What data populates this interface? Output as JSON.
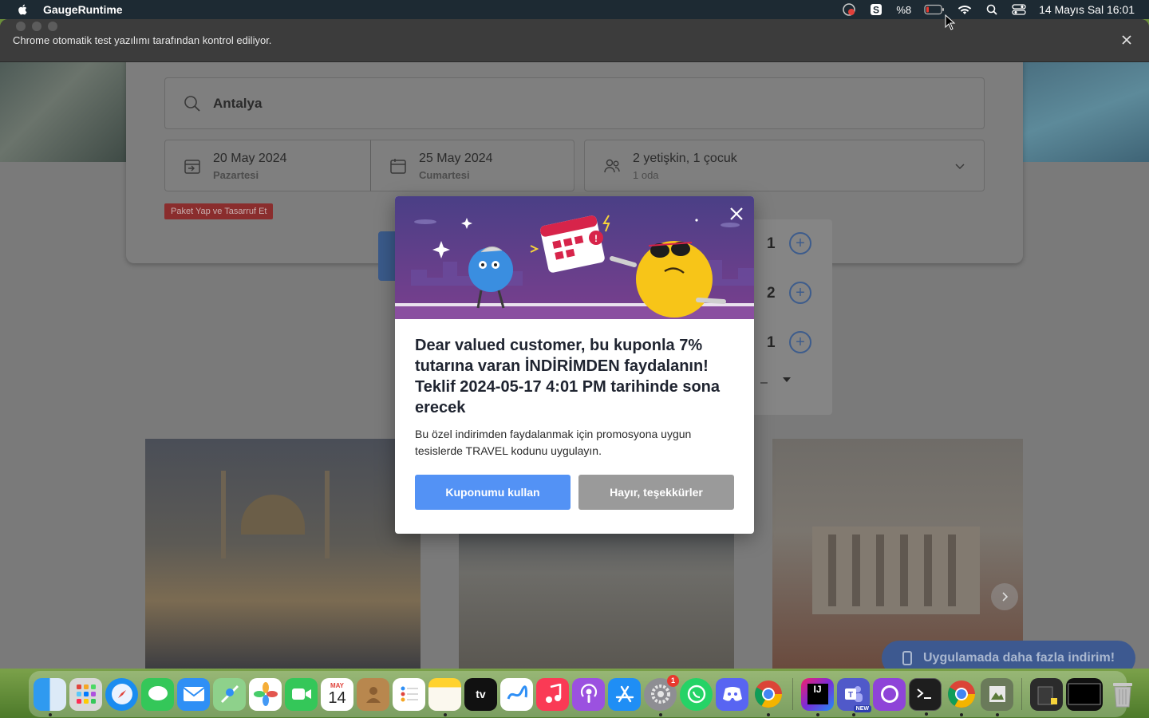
{
  "menubar": {
    "app_name": "GaugeRuntime",
    "battery": "%8",
    "datetime": "14 Mayıs Sal  16:01"
  },
  "chrome": {
    "infobar_text": "Chrome otomatik test yazılımı tarafından kontrol ediliyor."
  },
  "search": {
    "destination": "Antalya",
    "checkin_date": "20 May 2024",
    "checkin_day": "Pazartesi",
    "checkout_date": "25 May 2024",
    "checkout_day": "Cumartesi",
    "guests": "2 yetişkin, 1 çocuk",
    "rooms": "1 oda",
    "package_badge": "Paket Yap ve Tasarruf Et"
  },
  "guest_panel": {
    "rooms_count": "1",
    "adults_count": "2",
    "children_count": "1",
    "age_dash": "–"
  },
  "modal": {
    "title": "Dear valued customer, bu kuponla 7% tutarına varan İNDİRİMDEN faydalanın! Teklif 2024-05-17  4:01 PM tarihinde sona erecek",
    "body": "Bu özel indirimden faydalanmak için promosyona uygun tesislerde TRAVEL kodunu uygulayın.",
    "use_button": "Kuponumu kullan",
    "decline_button": "Hayır, teşekkürler",
    "colors": {
      "primary": "#5392f5",
      "secondary": "#9a9a9a",
      "hero_bg": "#4a3f86"
    }
  },
  "app_promo": {
    "label": "Uygulamada daha fazla indirim!"
  },
  "dock": {
    "calendar_month": "MAY",
    "calendar_day": "14",
    "settings_badge": "1",
    "teams_badge": "NEW",
    "appletv_label": "tv",
    "intellij_label": "IJ",
    "apps": [
      "finder-icon",
      "launchpad-icon",
      "safari-icon",
      "messages-icon",
      "mail-icon",
      "maps-icon",
      "photos-icon",
      "facetime-icon",
      "calendar-icon",
      "contacts-icon",
      "reminders-icon",
      "notes-icon",
      "appletv-icon",
      "freeform-icon",
      "music-icon",
      "podcasts-icon",
      "appstore-icon",
      "settings-icon",
      "whatsapp-icon",
      "discord-icon",
      "chrome-icon",
      "intellij-icon",
      "teams-icon",
      "github-desktop-icon",
      "terminal-icon",
      "chrome-icon",
      "preview-icon",
      "trash-icon"
    ]
  }
}
